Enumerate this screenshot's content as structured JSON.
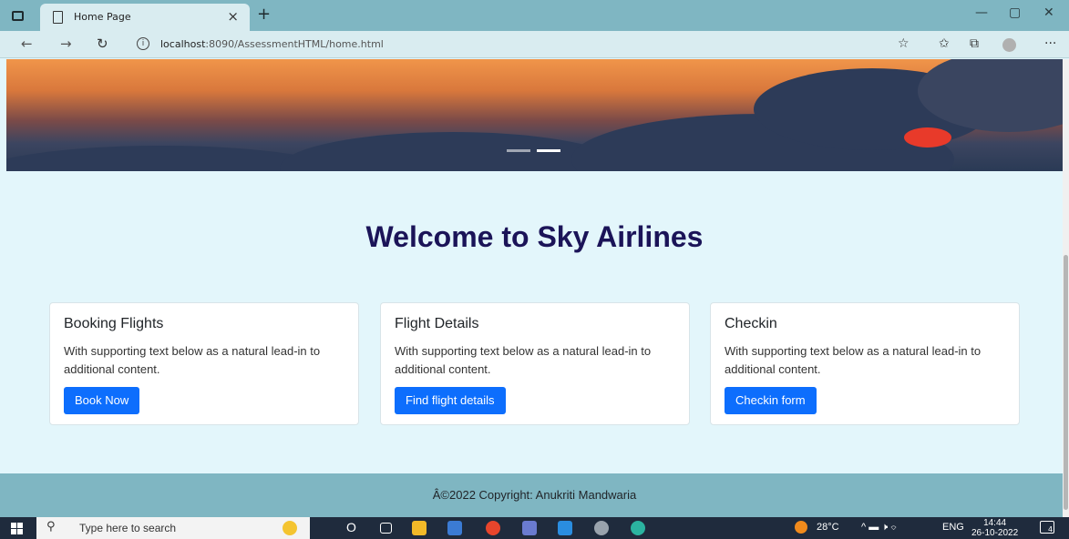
{
  "browser": {
    "tab_title": "Home Page",
    "tab_close": "×",
    "new_tab": "+",
    "url_host": "localhost",
    "url_rest": ":8090/AssessmentHTML/home.html",
    "info_glyph": "i",
    "controls": {
      "minimize": "—",
      "maximize": "▢",
      "close": "✕"
    },
    "nav": {
      "back": "←",
      "forward": "→",
      "refresh": "↻"
    },
    "addr_icons": {
      "favorite": "☆",
      "favorites": "✩",
      "collections": "⧉",
      "more": "···"
    }
  },
  "hero": {
    "indicators": [
      {
        "active": false
      },
      {
        "active": true
      }
    ]
  },
  "main": {
    "heading": "Welcome to Sky Airlines",
    "cards": [
      {
        "title": "Booking Flights",
        "text": "With supporting text below as a natural lead-in to additional content.",
        "button": "Book Now"
      },
      {
        "title": "Flight Details",
        "text": "With supporting text below as a natural lead-in to additional content.",
        "button": "Find flight details"
      },
      {
        "title": "Checkin",
        "text": "With supporting text below as a natural lead-in to additional content.",
        "button": "Checkin form"
      }
    ]
  },
  "footer": {
    "text": "Â©2022 Copyright: Anukriti Mandwaria"
  },
  "taskbar": {
    "search_placeholder": "Type here to search",
    "search_glyph": "⚲",
    "cortana": "O",
    "weather": "28°C",
    "tray_icons": "^  ▬  🕨  ⌔",
    "language": "ENG",
    "time": "14:44",
    "date": "26-10-2022",
    "notification_count": "4"
  },
  "colors": {
    "chrome": "#7fb6c2",
    "accent": "#0d6efd",
    "heading": "#1b1458",
    "page_bg": "#e3f6fb"
  }
}
